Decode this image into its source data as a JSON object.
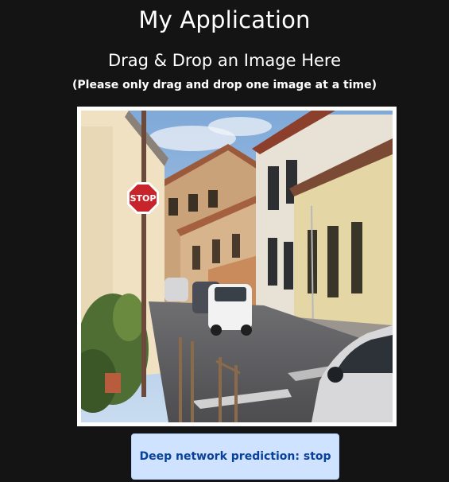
{
  "app": {
    "title": "My Application"
  },
  "dropzone": {
    "heading": "Drag & Drop an Image Here",
    "instructions": "(Please only drag and drop one image at a time)"
  },
  "image": {
    "description_icon": "street-photo",
    "sign_text": "STOP"
  },
  "prediction": {
    "label": "Deep network prediction: stop"
  },
  "colors": {
    "background": "#141414",
    "alert_background": "#cfe2ff",
    "alert_text": "#084298"
  }
}
